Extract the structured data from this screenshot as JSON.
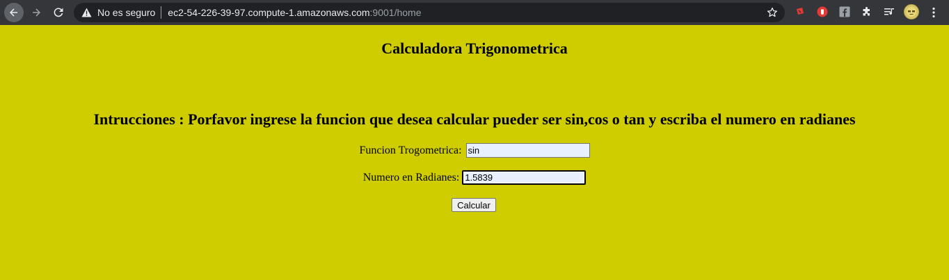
{
  "browser": {
    "security_label": "No es seguro",
    "url_host": "ec2-54-226-39-97.compute-1.amazonaws.com",
    "url_rest": ":9001/home",
    "icons": [
      "back-arrow-icon",
      "forward-arrow-icon",
      "reload-icon",
      "warning-icon",
      "star-icon",
      "extension-icon",
      "puzzle-icon",
      "media-icon",
      "avatar",
      "more-vert-icon"
    ]
  },
  "page": {
    "title": "Calculadora Trigonometrica",
    "instructions": "Intrucciones : Porfavor ingrese la funcion que desea calcular pueder ser sin,cos o tan y escriba el numero en radianes",
    "function_label": "Funcion Trogometrica:",
    "function_value": "sin",
    "radians_label": "Numero en Radianes:",
    "radians_value": "1.5839",
    "submit_label": "Calcular"
  },
  "colors": {
    "page_background": "#cfcd00",
    "chrome_background": "#35363a",
    "omnibox_background": "#202124",
    "input_autofill": "#e8f0fe"
  }
}
